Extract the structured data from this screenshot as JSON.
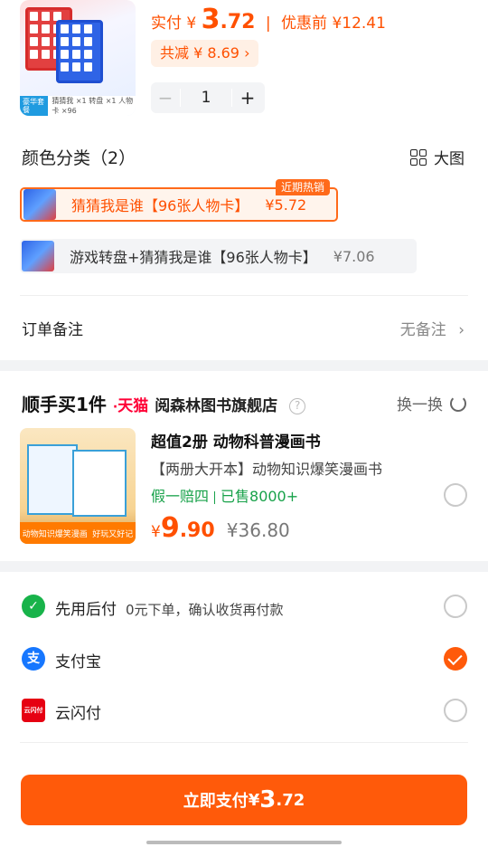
{
  "product": {
    "thumb_tag": "豪华套餐",
    "thumb_desc": "猜猜我 ×1   转盘 ×1   人物卡 ×96",
    "price_prefix": "实付",
    "currency": "¥",
    "price_int": "3",
    "price_dec": ".72",
    "before_label": "优惠前",
    "before_price": "¥12.41",
    "discount": "共减 ¥ 8.69 ›",
    "stepper": {
      "minus": "−",
      "qty": "1",
      "plus": "+"
    }
  },
  "color_section": {
    "title": "颜色分类（2）",
    "big_image_label": "大图",
    "hot_badge": "近期热销",
    "variants": [
      {
        "label": "猜猜我是谁【96张人物卡】",
        "price": "¥5.72"
      },
      {
        "label": "游戏转盘+猜猜我是谁【96张人物卡】",
        "price": "¥7.06"
      }
    ]
  },
  "order_note": {
    "label": "订单备注",
    "value": "无备注"
  },
  "side_buy": {
    "title": "顺手买1件",
    "platform": "天猫",
    "store": "阅森林图书旗舰店",
    "help": "?",
    "swap_label": "换一换",
    "item": {
      "title": "超值2册 动物科普漫画书",
      "desc": "【两册大开本】动物知识爆笑漫画书",
      "tag1": "假一赔四",
      "tag2": "已售8000+",
      "currency": "¥",
      "price_int": "9",
      "price_dec": ".90",
      "orig_price": "¥36.80",
      "thumb_band_left": "动物知识爆笑漫画",
      "thumb_band_right": "好玩又好记"
    }
  },
  "payment": {
    "options": [
      {
        "label": "先用后付",
        "sub": "0元下单，确认收货再付款",
        "icon": "✓",
        "selected": false
      },
      {
        "label": "支付宝",
        "icon": "支",
        "selected": true
      },
      {
        "label": "云闪付",
        "icon": "云闪付",
        "selected": false
      }
    ],
    "button_prefix": "立即支付",
    "button_currency": "¥",
    "button_int": "3",
    "button_dec": ".72"
  },
  "colors": {
    "accent": "#ff5a0a",
    "price": "#ff5000",
    "green": "#18a24a",
    "alipay": "#1677ff",
    "unionpay": "#e60012"
  }
}
